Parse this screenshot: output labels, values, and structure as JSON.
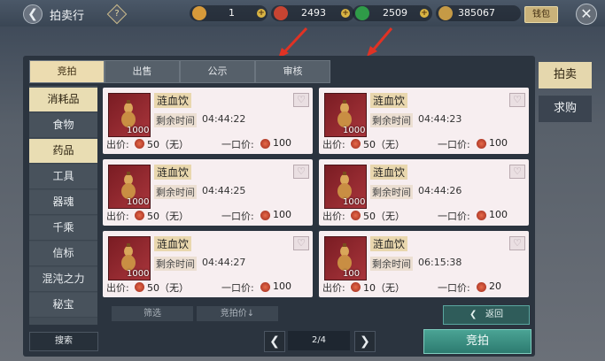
{
  "header": {
    "back_icon": "back-arrow-icon",
    "title": "拍卖行",
    "help_label": "?",
    "resources": [
      {
        "icon": "gold-ingot-icon",
        "value": "1",
        "color": "#d79a3a"
      },
      {
        "icon": "red-coin-icon",
        "value": "2493",
        "color": "#c84432"
      },
      {
        "icon": "green-jade-icon",
        "value": "2509",
        "color": "#2f9b48"
      },
      {
        "icon": "bronze-ticket-icon",
        "value": "385067",
        "color": "#c59a46"
      }
    ],
    "purse_label": "钱包",
    "close_icon": "close-icon"
  },
  "tabs": [
    "竞拍",
    "出售",
    "公示",
    "审核"
  ],
  "active_tab": 0,
  "categories": [
    "消耗品",
    "食物",
    "药品",
    "工具",
    "器魂",
    "千乘",
    "信标",
    "混沌之力",
    "秘宝"
  ],
  "active_category": [
    0,
    2
  ],
  "cards": [
    {
      "name": "涟血饮",
      "qty": "1000",
      "time_label": "剩余时间",
      "time": "04:44:22",
      "bid_label": "出价:",
      "bid": "50（无）",
      "buyout_label": "一口价:",
      "buyout": "100"
    },
    {
      "name": "涟血饮",
      "qty": "1000",
      "time_label": "剩余时间",
      "time": "04:44:23",
      "bid_label": "出价:",
      "bid": "50（无）",
      "buyout_label": "一口价:",
      "buyout": "100"
    },
    {
      "name": "涟血饮",
      "qty": "1000",
      "time_label": "剩余时间",
      "time": "04:44:25",
      "bid_label": "出价:",
      "bid": "50（无）",
      "buyout_label": "一口价:",
      "buyout": "100"
    },
    {
      "name": "涟血饮",
      "qty": "1000",
      "time_label": "剩余时间",
      "time": "04:44:26",
      "bid_label": "出价:",
      "bid": "50（无）",
      "buyout_label": "一口价:",
      "buyout": "100"
    },
    {
      "name": "涟血饮",
      "qty": "1000",
      "time_label": "剩余时间",
      "time": "04:44:27",
      "bid_label": "出价:",
      "bid": "50（无）",
      "buyout_label": "一口价:",
      "buyout": "100"
    },
    {
      "name": "涟血饮",
      "qty": "100",
      "time_label": "剩余时间",
      "time": "06:15:38",
      "bid_label": "出价:",
      "bid": "10（无）",
      "buyout_label": "一口价:",
      "buyout": "20"
    }
  ],
  "bottom": {
    "filter_label": "筛选",
    "sort_label": "竞拍价↓",
    "return_label": "返回",
    "search_label": "搜索",
    "prev_icon": "chevron-left-icon",
    "next_icon": "chevron-right-icon",
    "page": "2/4",
    "bid_button": "竞拍"
  },
  "side_tabs": [
    "拍卖",
    "求购"
  ],
  "active_side_tab": 0
}
